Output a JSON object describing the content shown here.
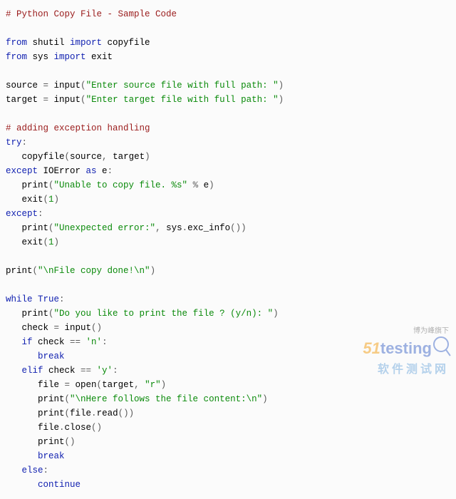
{
  "code": {
    "l1_comment": "# Python Copy File - Sample Code",
    "l3_from": "from",
    "l3_mod": " shutil ",
    "l3_import": "import",
    "l3_name": " copyfile",
    "l4_from": "from",
    "l4_mod": " sys ",
    "l4_import": "import",
    "l4_name": " exit",
    "l6_var": "source ",
    "l6_eq": "=",
    "l6_fn": " input",
    "l6_paren_o": "(",
    "l6_str": "\"Enter source file with full path: \"",
    "l6_paren_c": ")",
    "l7_var": "target ",
    "l7_eq": "=",
    "l7_fn": " input",
    "l7_paren_o": "(",
    "l7_str": "\"Enter target file with full path: \"",
    "l7_paren_c": ")",
    "l9_comment": "# adding exception handling",
    "l10_try": "try",
    "l10_colon": ":",
    "l11_fn": "   copyfile",
    "l11_po": "(",
    "l11_a1": "source",
    "l11_cm": ",",
    "l11_a2": " target",
    "l11_pc": ")",
    "l12_except": "except",
    "l12_err": " IOError ",
    "l12_as": "as",
    "l12_e": " e",
    "l12_colon": ":",
    "l13_fn": "   print",
    "l13_po": "(",
    "l13_str": "\"Unable to copy file. %s\"",
    "l13_pct": " %",
    "l13_e": " e",
    "l13_pc": ")",
    "l14_fn": "   exit",
    "l14_po": "(",
    "l14_n": "1",
    "l14_pc": ")",
    "l15_except": "except",
    "l15_colon": ":",
    "l16_fn": "   print",
    "l16_po": "(",
    "l16_str": "\"Unexpected error:\"",
    "l16_cm": ",",
    "l16_a": " sys",
    "l16_dot": ".",
    "l16_m": "exc_info",
    "l16_p2": "())",
    "l17_fn": "   exit",
    "l17_po": "(",
    "l17_n": "1",
    "l17_pc": ")",
    "l19_fn": "print",
    "l19_po": "(",
    "l19_str": "\"\\nFile copy done!\\n\"",
    "l19_pc": ")",
    "l21_while": "while",
    "l21_true": " True",
    "l21_colon": ":",
    "l22_fn": "   print",
    "l22_po": "(",
    "l22_str": "\"Do you like to print the file ? (y/n): \"",
    "l22_pc": ")",
    "l23_var": "   check ",
    "l23_eq": "=",
    "l23_fn": " input",
    "l23_p": "()",
    "l24_if": "   if",
    "l24_v": " check ",
    "l24_eq": "==",
    "l24_str": " 'n'",
    "l24_colon": ":",
    "l25_break": "      break",
    "l26_elif": "   elif",
    "l26_v": " check ",
    "l26_eq": "==",
    "l26_str": " 'y'",
    "l26_colon": ":",
    "l27_var": "      file ",
    "l27_eq": "=",
    "l27_fn": " open",
    "l27_po": "(",
    "l27_a": "target",
    "l27_cm": ",",
    "l27_str": " \"r\"",
    "l27_pc": ")",
    "l28_fn": "      print",
    "l28_po": "(",
    "l28_str": "\"\\nHere follows the file content:\\n\"",
    "l28_pc": ")",
    "l29_fn": "      print",
    "l29_po": "(",
    "l29_a": "file",
    "l29_dot": ".",
    "l29_m": "read",
    "l29_p2": "())",
    "l30_a": "      file",
    "l30_dot": ".",
    "l30_m": "close",
    "l30_p": "()",
    "l31_fn": "      print",
    "l31_p": "()",
    "l32_break": "      break",
    "l33_else": "   else",
    "l33_colon": ":",
    "l34_continue": "      continue"
  },
  "watermark": {
    "top": "博为峰旗下",
    "num": "51",
    "word": "testing",
    "bottom": "软件测试网"
  }
}
